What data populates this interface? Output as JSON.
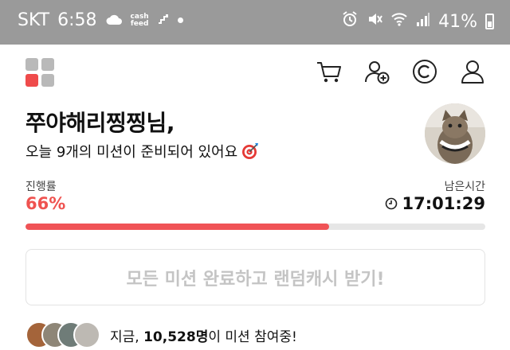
{
  "status_bar": {
    "carrier": "SKT",
    "time": "6:58",
    "notif_badge": "cash\nfeed",
    "battery": "41%"
  },
  "header": {
    "icons": [
      "app-logo-icon",
      "cart-icon",
      "add-friend-icon",
      "cash-coin-icon",
      "profile-icon"
    ]
  },
  "greeting": {
    "name": "쭈야해리찡찡님,",
    "subtitle": "오늘 9개의 미션이 준비되어 있어요",
    "subtitle_icon": "target-icon"
  },
  "progress": {
    "label": "진행률",
    "value_text": "66%",
    "fraction": 0.66
  },
  "time_left": {
    "label": "남은시간",
    "value": "17:01:29"
  },
  "cta": {
    "label": "모든 미션 완료하고 랜덤캐시 받기!"
  },
  "participants": {
    "prefix": "지금, ",
    "count": "10,528명",
    "suffix": "이 미션 참여중!"
  },
  "colors": {
    "accent": "#ef5350",
    "status_bar": "#9a9a9a"
  }
}
